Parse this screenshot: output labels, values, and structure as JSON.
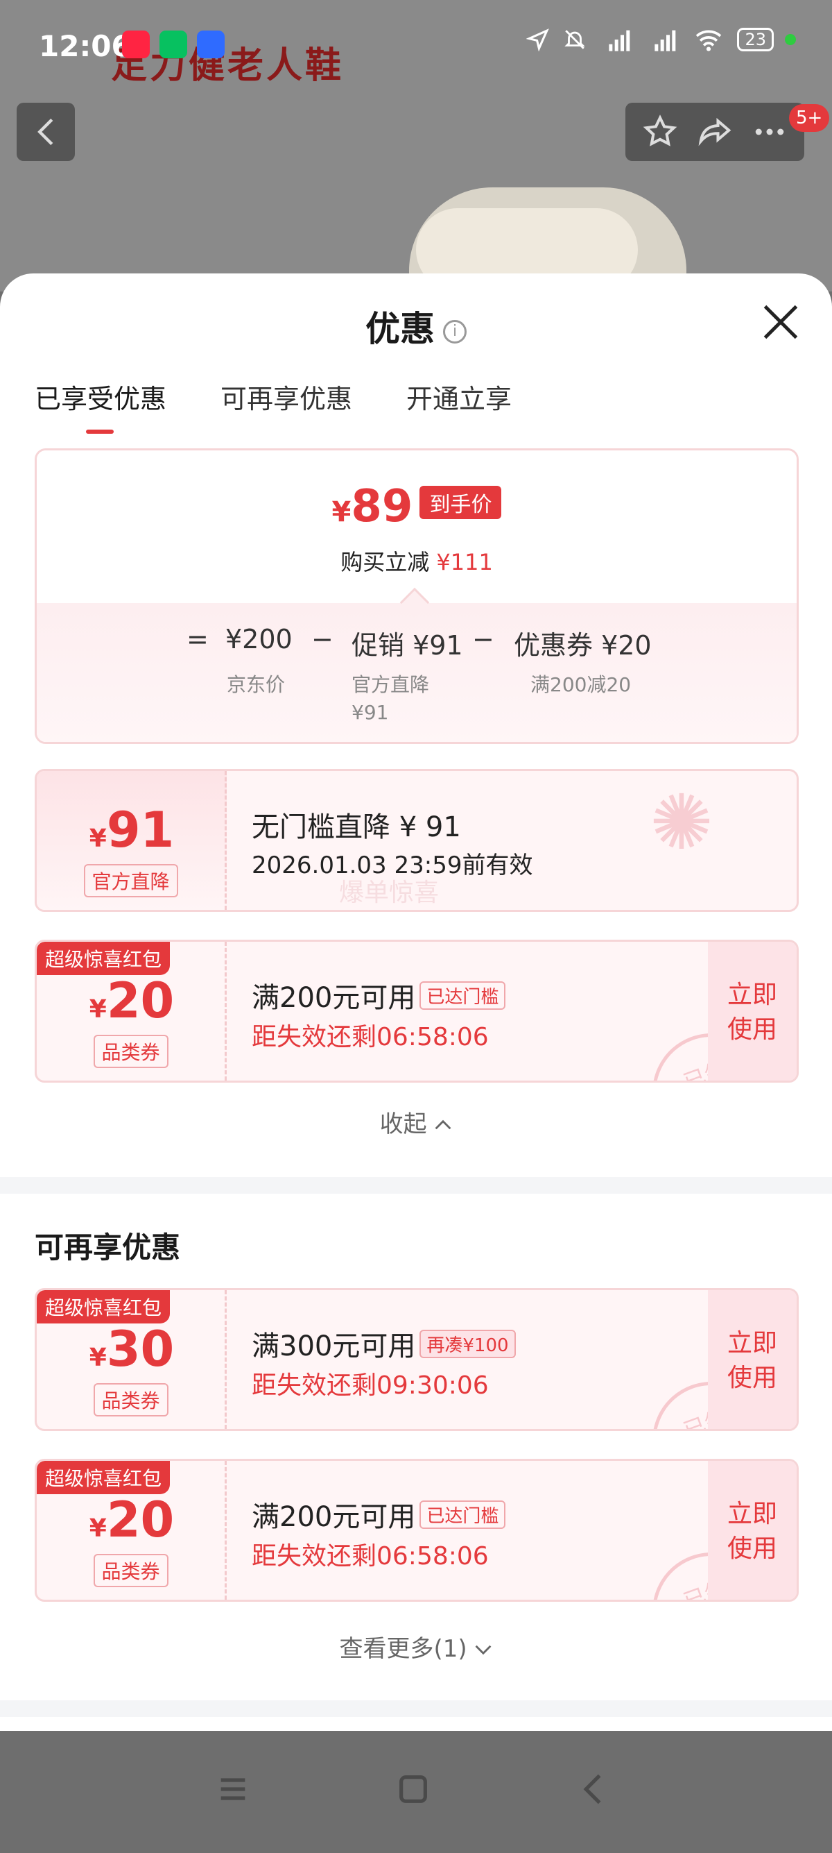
{
  "status_bar": {
    "time": "12:06",
    "battery": "23",
    "app_icons": [
      "xiaohongshu-icon",
      "wechat-icon",
      "app-shield-icon"
    ]
  },
  "background": {
    "brand_text": "足力健老人鞋",
    "more_badge": "5+"
  },
  "sheet": {
    "title": "优惠",
    "tabs": [
      "已享受优惠",
      "可再享优惠",
      "开通立享"
    ],
    "summary": {
      "final_price_symbol": "¥",
      "final_price": "89",
      "final_tag": "到手价",
      "reduce_label": "购买立减",
      "reduce_amount": "¥111",
      "eq": "=",
      "base_price": "¥200",
      "base_label": "京东价",
      "minus1": "−",
      "promo": "促销 ¥91",
      "promo_label": "官方直降",
      "promo_label_amount": "¥91",
      "minus2": "−",
      "coupon": "优惠券 ¥20",
      "coupon_label": "满200减20"
    },
    "enjoyed": [
      {
        "symbol": "¥",
        "amount": "91",
        "kind": "官方直降",
        "title": "无门槛直降 ¥ 91",
        "sub": "2026.01.03 23:59前有效",
        "watermark": "爆单惊喜"
      },
      {
        "ribbon": "超级惊喜红包",
        "symbol": "¥",
        "amount": "20",
        "kind": "品类券",
        "title": "满200元可用",
        "pill": "已达门槛",
        "sub": "距失效还剩06:58:06",
        "use": "立即使用",
        "stamp": "已领"
      }
    ],
    "collapse_label": "收起",
    "section2_title": "可再享优惠",
    "more_coupons": [
      {
        "ribbon": "超级惊喜红包",
        "symbol": "¥",
        "amount": "30",
        "kind": "品类券",
        "title": "满300元可用",
        "pill": "再凑¥100",
        "sub": "距失效还剩09:30:06",
        "use": "立即使用",
        "stamp": "已领"
      },
      {
        "ribbon": "超级惊喜红包",
        "symbol": "¥",
        "amount": "20",
        "kind": "品类券",
        "title": "满200元可用",
        "pill": "已达门槛",
        "sub": "距失效还剩06:58:06",
        "use": "立即使用",
        "stamp": "已领"
      }
    ],
    "view_more_label": "查看更多(1)"
  },
  "colors": {
    "accent": "#e4393c",
    "coupon_bg": "#fff5f6",
    "coupon_border": "#f6d5d7"
  }
}
